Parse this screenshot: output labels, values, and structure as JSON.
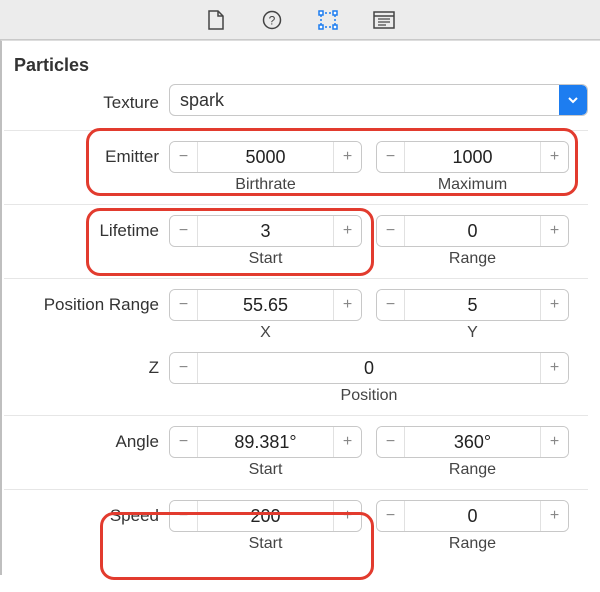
{
  "section_title": "Particles",
  "texture_label": "Texture",
  "texture_value": "spark",
  "rows": {
    "emitter": {
      "label": "Emitter",
      "f1": {
        "value": "5000",
        "sub": "Birthrate"
      },
      "f2": {
        "value": "1000",
        "sub": "Maximum"
      }
    },
    "lifetime": {
      "label": "Lifetime",
      "f1": {
        "value": "3",
        "sub": "Start"
      },
      "f2": {
        "value": "0",
        "sub": "Range"
      }
    },
    "posrange": {
      "label": "Position Range",
      "f1": {
        "value": "55.65",
        "sub": "X"
      },
      "f2": {
        "value": "5",
        "sub": "Y"
      }
    },
    "z": {
      "label": "Z",
      "f1": {
        "value": "0",
        "sub": "Position"
      }
    },
    "angle": {
      "label": "Angle",
      "f1": {
        "value": "89.381°",
        "sub": "Start"
      },
      "f2": {
        "value": "360°",
        "sub": "Range"
      }
    },
    "speed": {
      "label": "Speed",
      "f1": {
        "value": "200",
        "sub": "Start"
      },
      "f2": {
        "value": "0",
        "sub": "Range"
      }
    }
  }
}
